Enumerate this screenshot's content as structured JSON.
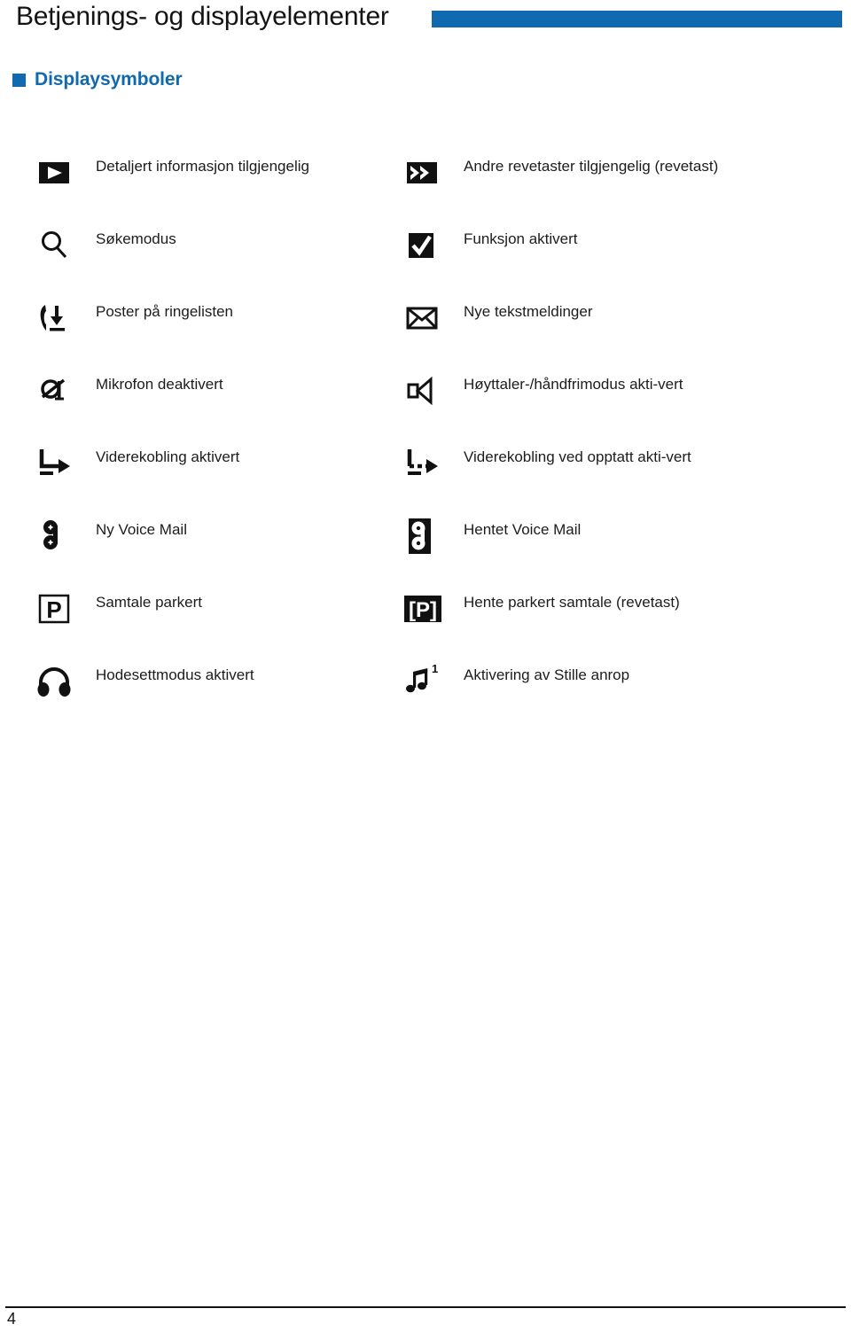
{
  "header": {
    "title": "Betjenings- og displayelementer",
    "rule_color": "#1169b0"
  },
  "section": {
    "heading": "Displaysymboler",
    "bullet_color": "#1169b0",
    "heading_color": "#1169b0"
  },
  "symbols": {
    "rows": [
      {
        "left": {
          "icon": "play-triangle-filled-icon",
          "label": "Detaljert informasjon tilgjengelig"
        },
        "right": {
          "icon": "double-chevron-right-filled-icon",
          "label": "Andre revetaster tilgjengelig (revetast)"
        }
      },
      {
        "left": {
          "icon": "magnifier-search-icon",
          "label": "Søkemodus"
        },
        "right": {
          "icon": "checkmark-filled-box-icon",
          "label": "Funksjon aktivert"
        }
      },
      {
        "left": {
          "icon": "handset-download-icon",
          "label": "Poster på ringelisten"
        },
        "right": {
          "icon": "envelope-icon",
          "label": "Nye tekstmeldinger"
        }
      },
      {
        "left": {
          "icon": "microphone-muted-icon",
          "label": "Mikrofon deaktivert"
        },
        "right": {
          "icon": "loudspeaker-icon",
          "label": "Høyttaler-/håndfrimodus akti-vert"
        }
      },
      {
        "left": {
          "icon": "call-forward-arrow-icon",
          "label": "Viderekobling aktivert"
        },
        "right": {
          "icon": "call-forward-busy-arrow-icon",
          "label": "Viderekobling ved opptatt akti-vert"
        }
      },
      {
        "left": {
          "icon": "voicemail-tape-icon",
          "label": "Ny Voice Mail"
        },
        "right": {
          "icon": "voicemail-tape-inverted-icon",
          "label": "Hentet Voice Mail"
        }
      },
      {
        "left": {
          "icon": "parking-p-box-icon",
          "label": "Samtale parkert"
        },
        "right": {
          "icon": "parking-p-bracket-inverted-icon",
          "label": "Hente parkert samtale (revetast)"
        }
      },
      {
        "left": {
          "icon": "headset-icon",
          "label": "Hodesettmodus aktivert"
        },
        "right": {
          "icon": "music-note-superscript-one-icon",
          "label": "Aktivering av Stille anrop"
        }
      }
    ]
  },
  "footer": {
    "page_number": "4"
  }
}
